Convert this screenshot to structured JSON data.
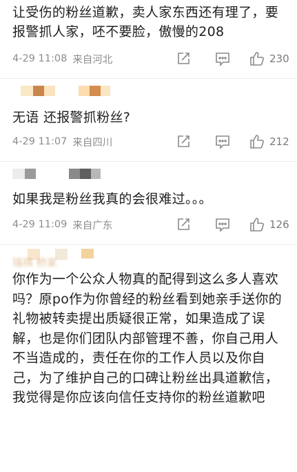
{
  "comments": [
    {
      "text": "让受伤的粉丝道歉，卖人家东西还有理了，要报警抓人家，呸不要脸，傲慢的208",
      "time": "4-29 11:08",
      "location": "来自河北",
      "likes": "230"
    },
    {
      "text": "无语 还报警抓粉丝?",
      "time": "4-29 11:07",
      "location": "来自四川",
      "likes": "212"
    },
    {
      "text": "如果我是粉丝我真的会很难过。。。",
      "time": "4-29 11:09",
      "location": "来自广东",
      "likes": "126"
    },
    {
      "username_blurred": "瑞祺  桥家",
      "text": "你作为一个公众人物真的配得到这么多人喜欢吗？原po作为你曾经的粉丝看到她亲手送你的礼物被转卖提出质疑很正常，如果造成了误解，也是你们团队内部管理不善，你自己用人不当造成的，责任在你的工作人员以及你自己，为了维护自己的口碑让粉丝出具道歉信，我觉得是你应该向信任支持你的粉丝道歉吧"
    }
  ],
  "icons": {
    "repost": "share-square-icon",
    "comment": "comment-bubble-icon",
    "like": "thumbs-up-icon"
  }
}
